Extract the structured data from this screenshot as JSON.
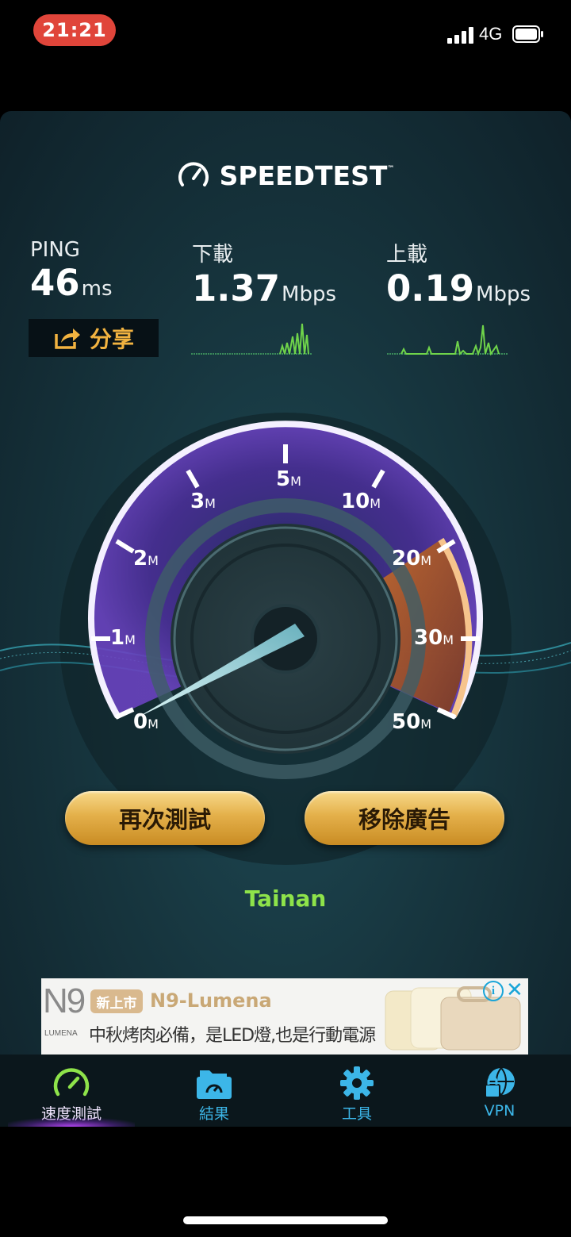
{
  "status": {
    "time": "21:21",
    "network": "4G"
  },
  "header": {
    "logo": "SPEEDTEST",
    "tm": "™"
  },
  "metrics": {
    "ping": {
      "label": "PING",
      "value": "46",
      "unit": "ms"
    },
    "download": {
      "label": "下載",
      "value": "1.37",
      "unit": "Mbps"
    },
    "upload": {
      "label": "上載",
      "value": "0.19",
      "unit": "Mbps"
    }
  },
  "share": {
    "label": "分享"
  },
  "gauge": {
    "ticks": [
      {
        "num": "0",
        "unit": "M"
      },
      {
        "num": "1",
        "unit": "M"
      },
      {
        "num": "2",
        "unit": "M"
      },
      {
        "num": "3",
        "unit": "M"
      },
      {
        "num": "5",
        "unit": "M"
      },
      {
        "num": "10",
        "unit": "M"
      },
      {
        "num": "20",
        "unit": "M"
      },
      {
        "num": "30",
        "unit": "M"
      },
      {
        "num": "50",
        "unit": "M"
      }
    ],
    "needle_value_mbps": 0.19
  },
  "buttons": {
    "retest": "再次測試",
    "remove_ads": "移除廣告"
  },
  "server": {
    "name": "Tainan"
  },
  "ad": {
    "brand": "N9",
    "brand_small": "LUMENA",
    "tag": "新上市",
    "headline": "N9-Lumena",
    "subline": "中秋烤肉必備，是LED燈,也是行動電源",
    "info": "i",
    "close": "✕"
  },
  "tabs": [
    {
      "label": "速度測試",
      "icon": "speedometer-icon",
      "active": true
    },
    {
      "label": "結果",
      "icon": "results-folder-icon",
      "active": false
    },
    {
      "label": "工具",
      "icon": "gear-icon",
      "active": false
    },
    {
      "label": "VPN",
      "icon": "vpn-globe-lock-icon",
      "active": false
    }
  ],
  "colors": {
    "accent_gold": "#e4b04a",
    "server_green": "#8ee34a",
    "tab_blue": "#3cb6e8",
    "active_purple": "#b044f0",
    "time_pill": "#e0453a"
  }
}
